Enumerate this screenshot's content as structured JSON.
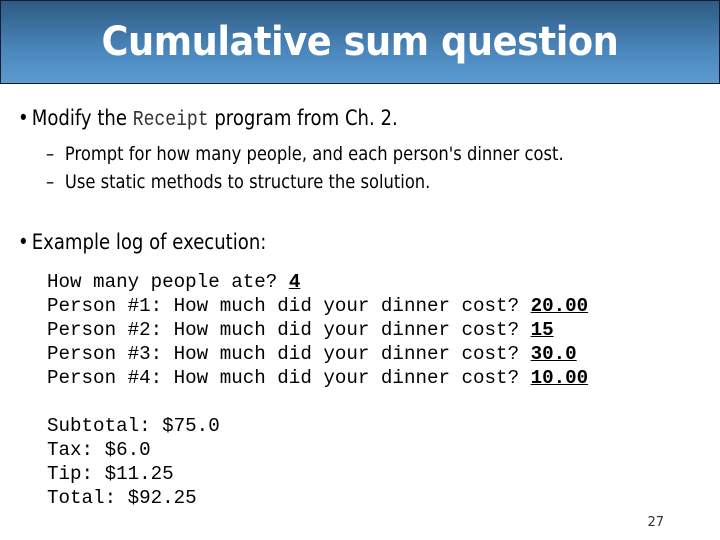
{
  "slide": {
    "title": "Cumulative sum question",
    "page_number": "27"
  },
  "bullets": [
    {
      "prefix": "Modify the ",
      "code": "Receipt",
      "suffix": " program from Ch. 2.",
      "subitems": [
        "Prompt for how many people, and each person's dinner cost.",
        "Use static methods to structure the solution."
      ]
    },
    {
      "text": "Example log of execution:"
    }
  ],
  "console": {
    "prompts": [
      {
        "prompt": "How many people ate? ",
        "input": "4"
      },
      {
        "prompt": "Person #1: How much did your dinner cost? ",
        "input": "20.00"
      },
      {
        "prompt": "Person #2: How much did your dinner cost? ",
        "input": "15"
      },
      {
        "prompt": "Person #3: How much did your dinner cost? ",
        "input": "30.0"
      },
      {
        "prompt": "Person #4: How much did your dinner cost? ",
        "input": "10.00"
      }
    ],
    "results": [
      "Subtotal: $75.0",
      "Tax: $6.0",
      "Tip: $11.25",
      "Total: $92.25"
    ]
  },
  "glyphs": {
    "bullet": "•",
    "dash": "–"
  }
}
